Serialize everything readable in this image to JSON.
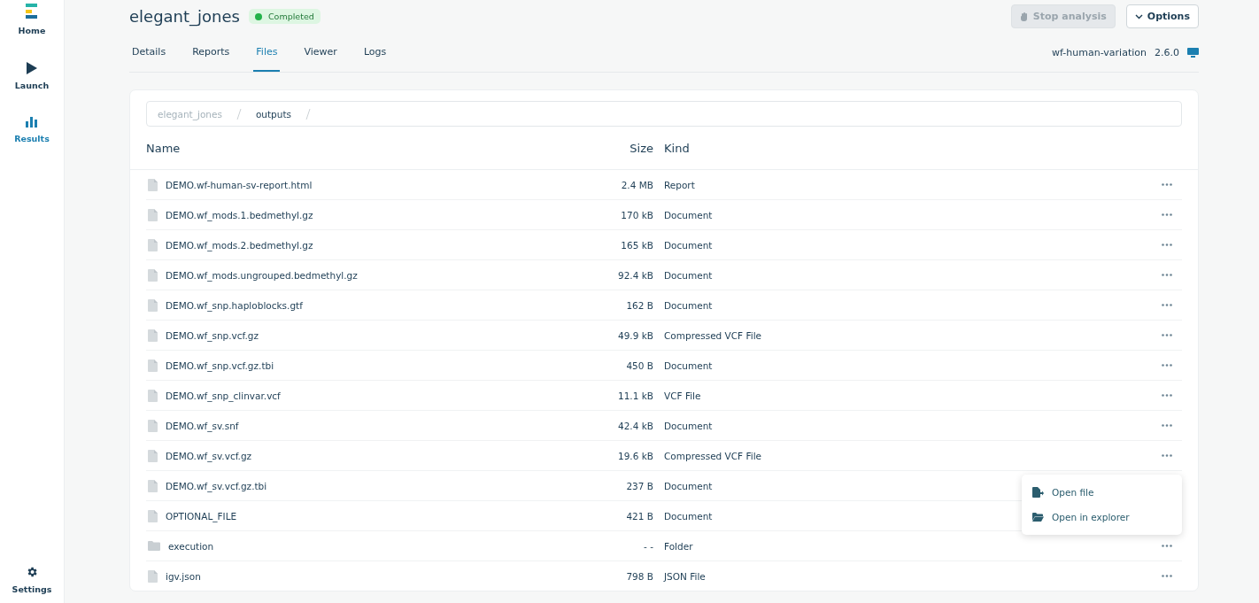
{
  "sidebar": {
    "items": [
      {
        "label": "Home",
        "selected": false
      },
      {
        "label": "Launch",
        "selected": false
      },
      {
        "label": "Results",
        "selected": true
      }
    ],
    "bottom_item": {
      "label": "Settings",
      "selected": false
    }
  },
  "header": {
    "title": "elegant_jones",
    "status": "Completed",
    "stop_button": {
      "label": "Stop analysis",
      "disabled": true
    },
    "options_button": "Options"
  },
  "tabs": [
    {
      "label": "Details",
      "selected": false
    },
    {
      "label": "Reports",
      "selected": false
    },
    {
      "label": "Files",
      "selected": true
    },
    {
      "label": "Viewer",
      "selected": false
    },
    {
      "label": "Logs",
      "selected": false
    }
  ],
  "workflow": {
    "name": "wf-human-variation",
    "version": "2.6.0"
  },
  "breadcrumb": [
    "elegant_jones",
    "outputs"
  ],
  "table": {
    "columns": [
      "Name",
      "Size",
      "Kind"
    ],
    "rows": [
      {
        "name": "DEMO.wf-human-sv-report.html",
        "size": "2.4 MB",
        "type_label": "Report",
        "kind": "file"
      },
      {
        "name": "DEMO.wf_mods.1.bedmethyl.gz",
        "size": "170 kB",
        "type_label": "Document",
        "kind": "file"
      },
      {
        "name": "DEMO.wf_mods.2.bedmethyl.gz",
        "size": "165 kB",
        "type_label": "Document",
        "kind": "file"
      },
      {
        "name": "DEMO.wf_mods.ungrouped.bedmethyl.gz",
        "size": "92.4 kB",
        "type_label": "Document",
        "kind": "file"
      },
      {
        "name": "DEMO.wf_snp.haploblocks.gtf",
        "size": "162 B",
        "type_label": "Document",
        "kind": "file"
      },
      {
        "name": "DEMO.wf_snp.vcf.gz",
        "size": "49.9 kB",
        "type_label": "Compressed VCF File",
        "kind": "file"
      },
      {
        "name": "DEMO.wf_snp.vcf.gz.tbi",
        "size": "450 B",
        "type_label": "Document",
        "kind": "file"
      },
      {
        "name": "DEMO.wf_snp_clinvar.vcf",
        "size": "11.1 kB",
        "type_label": "VCF File",
        "kind": "file"
      },
      {
        "name": "DEMO.wf_sv.snf",
        "size": "42.4 kB",
        "type_label": "Document",
        "kind": "file"
      },
      {
        "name": "DEMO.wf_sv.vcf.gz",
        "size": "19.6 kB",
        "type_label": "Compressed VCF File",
        "kind": "file",
        "menu_open": true
      },
      {
        "name": "DEMO.wf_sv.vcf.gz.tbi",
        "size": "237 B",
        "type_label": "Document",
        "kind": "file"
      },
      {
        "name": "OPTIONAL_FILE",
        "size": "421 B",
        "type_label": "Document",
        "kind": "file"
      },
      {
        "name": "execution",
        "size": "- -",
        "type_label": "Folder",
        "kind": "folder"
      },
      {
        "name": "igv.json",
        "size": "798 B",
        "type_label": "JSON File",
        "kind": "file"
      }
    ]
  },
  "context_menu": [
    "Open file",
    "Open in explorer"
  ]
}
